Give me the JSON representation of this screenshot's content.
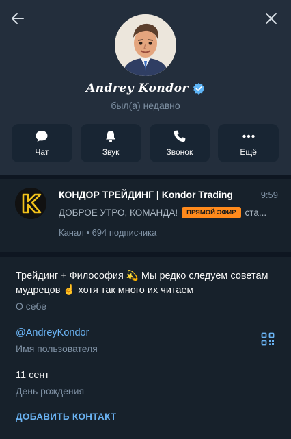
{
  "profile": {
    "name": "Andrey Kondor",
    "status": "был(а) недавно"
  },
  "actions": [
    {
      "label": "Чат",
      "icon": "chat-icon"
    },
    {
      "label": "Звук",
      "icon": "bell-icon"
    },
    {
      "label": "Звонок",
      "icon": "phone-icon"
    },
    {
      "label": "Ещё",
      "icon": "more-icon"
    }
  ],
  "channel": {
    "title": "КОНДОР ТРЕЙДИНГ | Kondor Trading",
    "time": "9:59",
    "message": "ДОБРОЕ УТРО, КОМАНДА!",
    "badge": "ПРЯМОЙ ЭФИР",
    "message_tail": "ста...",
    "subtitle": "Канал • 694 подписчика"
  },
  "info": {
    "bio_line1": "Трейдинг + Философия 💫 Мы редко следуем советам",
    "bio_line2": "мудрецов ☝️ хотя так много их читаем",
    "bio_label": "О себе",
    "username": "@AndreyKondor",
    "username_label": "Имя пользователя",
    "birthday": "11 сент",
    "birthday_label": "День рождения",
    "add_contact": "ДОБАВИТЬ КОНТАКТ"
  },
  "colors": {
    "background": "#17212b",
    "header": "#232e3c",
    "accent": "#6ab3f3",
    "badge": "#ff8a1c",
    "verified": "#5eb5f7"
  }
}
